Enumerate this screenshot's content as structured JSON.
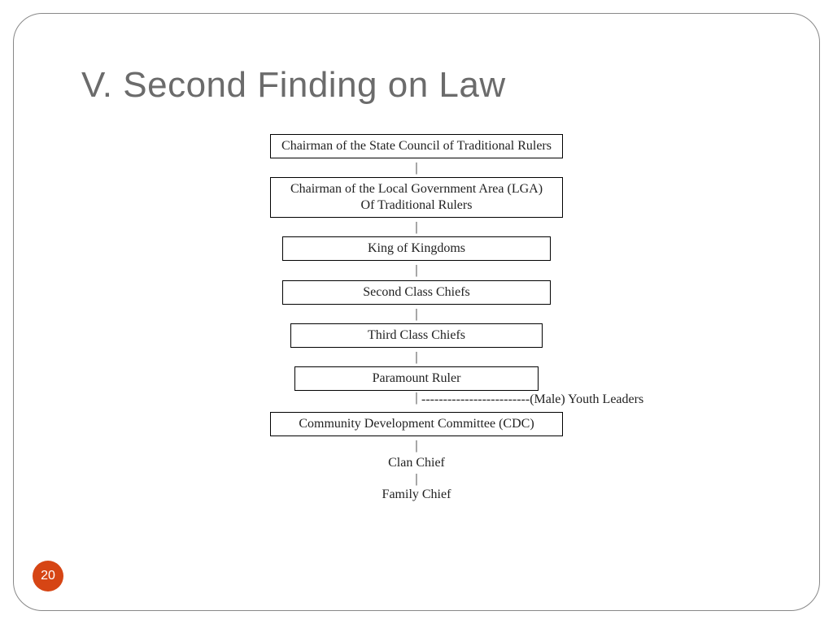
{
  "title": "V. Second Finding on Law",
  "page_number": "20",
  "hierarchy": {
    "level1": "Chairman of the State Council of Traditional Rulers",
    "level2_line1": "Chairman of the Local Government Area (LGA)",
    "level2_line2": "Of Traditional Rulers",
    "level3": "King of Kingdoms",
    "level4": "Second Class Chiefs",
    "level5": "Third Class Chiefs",
    "level6": "Paramount Ruler",
    "branch_label": "(Male) Youth Leaders",
    "level7": "Community Development Committee (CDC)",
    "level8": "Clan Chief",
    "level9": "Family Chief"
  },
  "colors": {
    "accent": "#d64514",
    "title": "#6b6b6b"
  }
}
